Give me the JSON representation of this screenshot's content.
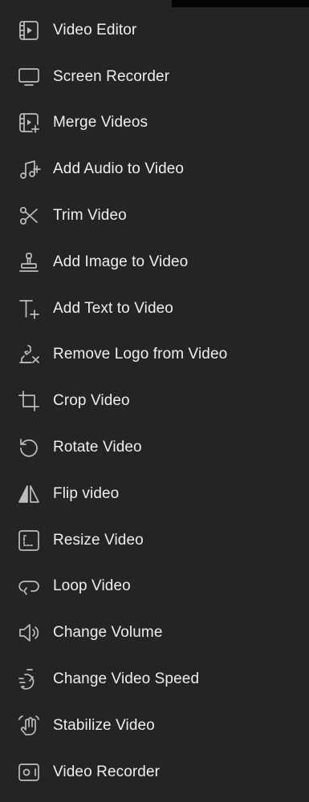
{
  "menu": {
    "items": [
      {
        "label": "Video Editor",
        "icon": "video-editor-icon"
      },
      {
        "label": "Screen Recorder",
        "icon": "monitor-icon"
      },
      {
        "label": "Merge Videos",
        "icon": "merge-videos-icon"
      },
      {
        "label": "Add Audio to Video",
        "icon": "music-note-plus-icon"
      },
      {
        "label": "Trim Video",
        "icon": "scissors-icon"
      },
      {
        "label": "Add Image to Video",
        "icon": "stamp-icon"
      },
      {
        "label": "Add Text to Video",
        "icon": "text-plus-icon"
      },
      {
        "label": "Remove Logo from Video",
        "icon": "remove-logo-icon"
      },
      {
        "label": "Crop Video",
        "icon": "crop-icon"
      },
      {
        "label": "Rotate Video",
        "icon": "rotate-icon"
      },
      {
        "label": "Flip video",
        "icon": "flip-icon"
      },
      {
        "label": "Resize Video",
        "icon": "resize-icon"
      },
      {
        "label": "Loop Video",
        "icon": "loop-icon"
      },
      {
        "label": "Change Volume",
        "icon": "volume-icon"
      },
      {
        "label": "Change Video Speed",
        "icon": "speed-timer-icon"
      },
      {
        "label": "Stabilize Video",
        "icon": "stabilize-hand-icon"
      },
      {
        "label": "Video Recorder",
        "icon": "video-recorder-icon"
      }
    ]
  },
  "colors": {
    "background": "#242424",
    "text": "#eeeeee",
    "icon": "#bdbdbd",
    "top_strip": "#050505"
  }
}
